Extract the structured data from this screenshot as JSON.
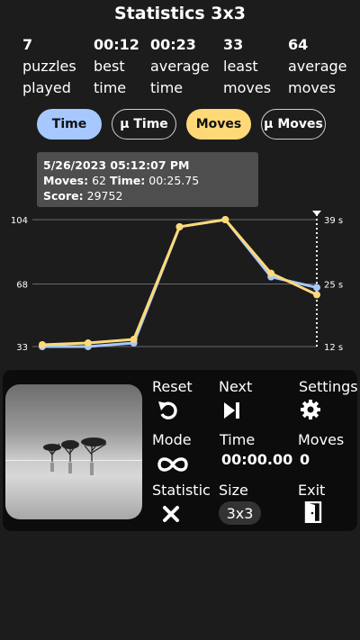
{
  "header": {
    "title": "Statistics 3x3"
  },
  "stats": [
    {
      "value": "7",
      "line1": "puzzles",
      "line2": "played"
    },
    {
      "value": "00:12",
      "line1": "best",
      "line2": "time"
    },
    {
      "value": "00:23",
      "line1": "average",
      "line2": "time"
    },
    {
      "value": "33",
      "line1": "least",
      "line2": "moves"
    },
    {
      "value": "64",
      "line1": "average",
      "line2": "moves"
    }
  ],
  "toggles": {
    "time": "Time",
    "mu_time": "μ Time",
    "moves": "Moves",
    "mu_moves": "μ Moves"
  },
  "tooltip": {
    "datetime": "5/26/2023 05:12:07 PM",
    "moves_label": "Moves:",
    "moves_value": "62",
    "time_label": "Time:",
    "time_value": "00:25.75",
    "score_label": "Score:",
    "score_value": "29752"
  },
  "chart_data": {
    "type": "line",
    "x": [
      1,
      2,
      3,
      4,
      5,
      6,
      7
    ],
    "y_left_ticks": [
      "104",
      "68",
      "33"
    ],
    "y_right_ticks": [
      "39 s",
      "25 s",
      "12 s"
    ],
    "ylim_moves": [
      33,
      104
    ],
    "ylim_time_s": [
      12,
      39
    ],
    "series": [
      {
        "name": "Time",
        "color": "#a6c8ff",
        "values": [
          33,
          33,
          35,
          100,
          104,
          72,
          66
        ]
      },
      {
        "name": "Moves",
        "color": "#ffd978",
        "values": [
          34,
          35,
          37,
          100,
          104,
          74,
          62
        ]
      }
    ],
    "grid": true
  },
  "controls": {
    "reset": "Reset",
    "next": "Next",
    "settings": "Settings",
    "mode": "Mode",
    "time_label": "Time",
    "time_value": "00:00.00",
    "moves_label": "Moves",
    "moves_value": "0",
    "statistic": "Statistic",
    "size_label": "Size",
    "size_value": "3x3",
    "exit": "Exit"
  },
  "colors": {
    "accent_blue": "#a6c8ff",
    "accent_yellow": "#ffd978",
    "background": "#1c1c1c",
    "panel": "#0c0c0c"
  },
  "icons": [
    "undo-icon",
    "skip-next-icon",
    "gear-icon",
    "infinity-icon",
    "close-icon",
    "exit-door-icon"
  ]
}
